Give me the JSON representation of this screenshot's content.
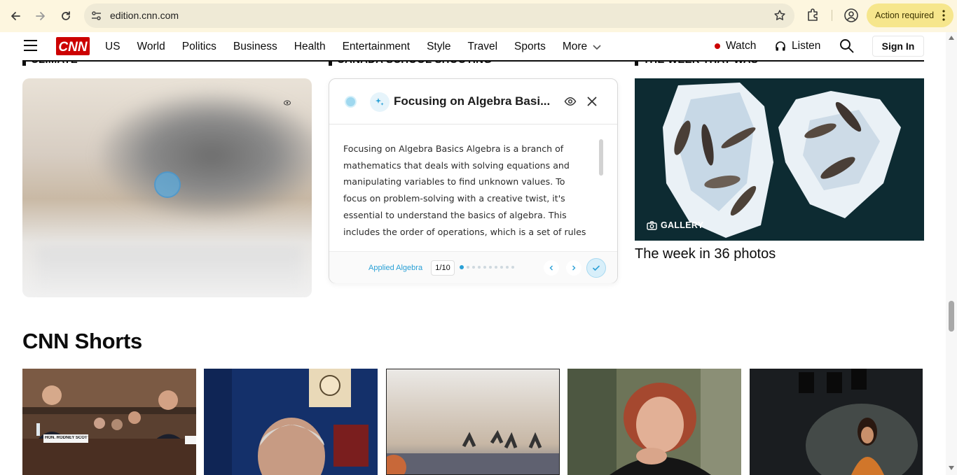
{
  "browser": {
    "url": "edition.cnn.com",
    "action_pill_label": "Action required"
  },
  "header": {
    "logo_text": "CNN",
    "nav": [
      {
        "label": "US"
      },
      {
        "label": "World"
      },
      {
        "label": "Politics"
      },
      {
        "label": "Business"
      },
      {
        "label": "Health"
      },
      {
        "label": "Entertainment"
      },
      {
        "label": "Style"
      },
      {
        "label": "Travel"
      },
      {
        "label": "Sports"
      },
      {
        "label": "More"
      }
    ],
    "watch_label": "Watch",
    "listen_label": "Listen",
    "signin_label": "Sign In"
  },
  "sections": {
    "left_label": "CLIMATE",
    "middle_label": "CANADA SCHOOL SHOOTING",
    "right_label": "THE WEEK THAT WAS"
  },
  "popup": {
    "title": "Focusing on Algebra Basi...",
    "body": "Focusing on Algebra Basics Algebra is a branch of mathematics that deals with solving equations and manipulating variables to find unknown values. To focus on problem-solving with a creative twist, it's essential to understand the basics of algebra. This includes the order of operations, which is a set of rules that tells us which",
    "topic": "Applied Algebra",
    "counter": "1/10",
    "total_steps": 10,
    "current_step": 1
  },
  "gallery": {
    "tag": "GALLERY",
    "title": "The week in 36 photos"
  },
  "shorts": {
    "title": "CNN Shorts",
    "thumb1_nameplate": "HON. RODNEY SCOTT"
  },
  "colors": {
    "cnn_red": "#cc0000",
    "chrome_bg": "#fdf6df",
    "action_pill": "#f6e68c",
    "accent_blue": "#2aa0d6"
  }
}
